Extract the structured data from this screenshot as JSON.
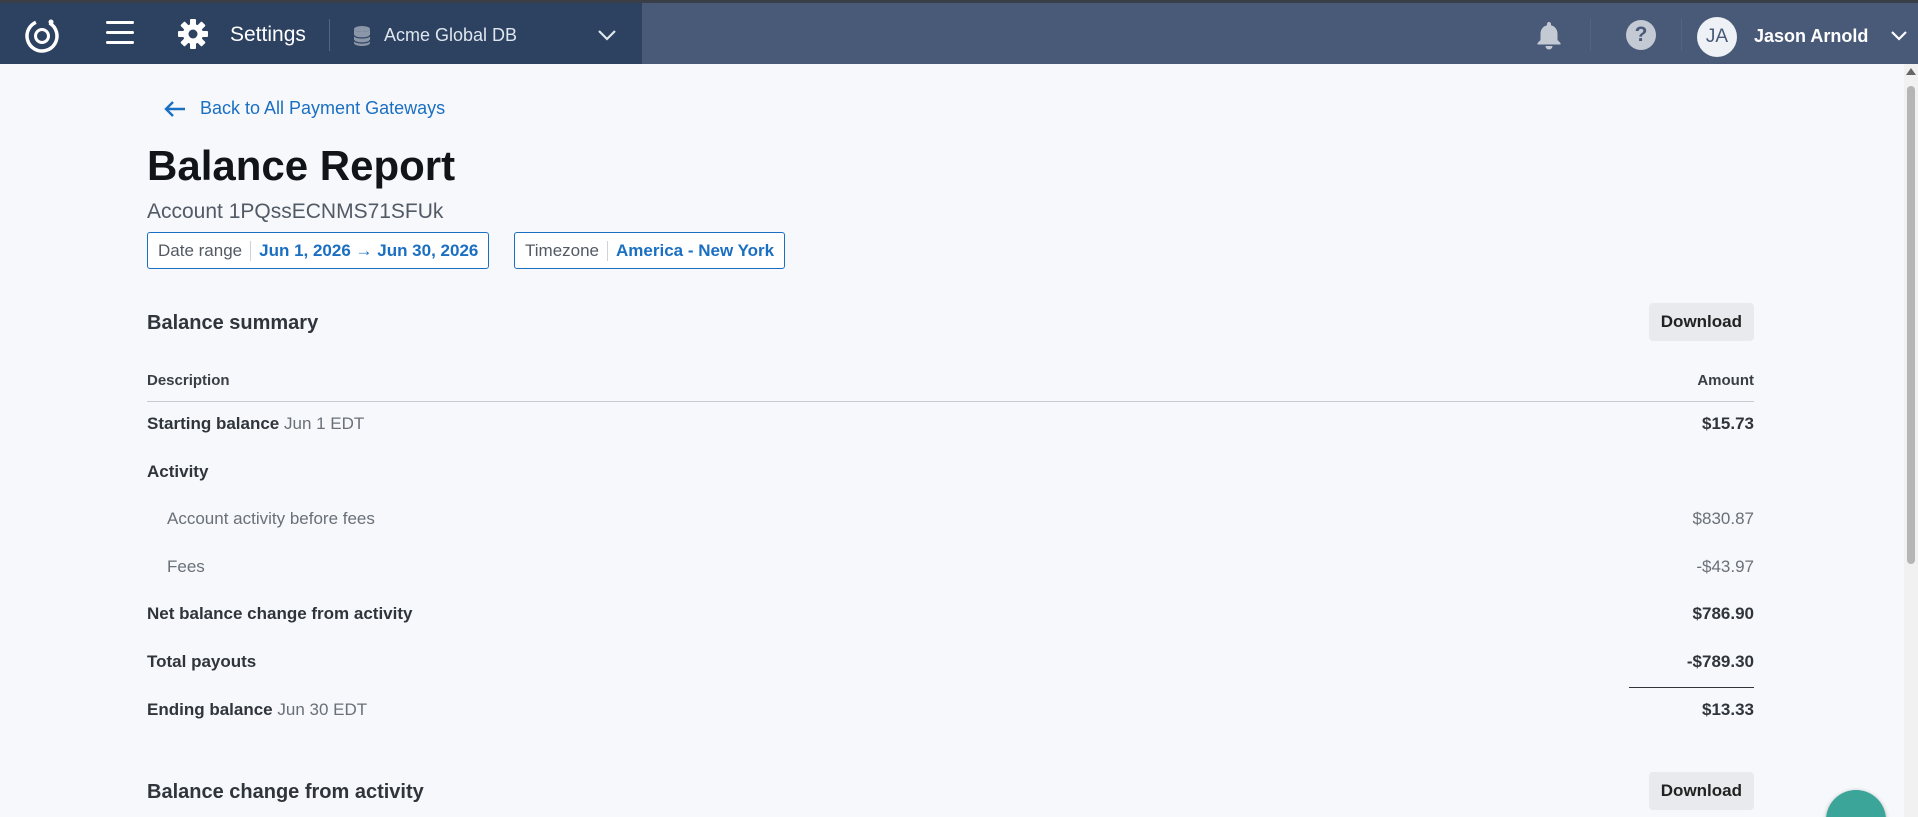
{
  "topbar": {
    "settings_label": "Settings",
    "database": "Acme Global DB",
    "user": {
      "initials": "JA",
      "name": "Jason Arnold"
    },
    "help_glyph": "?"
  },
  "page": {
    "back_link": "Back to All Payment Gateways",
    "title": "Balance Report",
    "account": "Account 1PQssECNMS71SFUk"
  },
  "filters": {
    "date_range": {
      "label": "Date range",
      "value": "Jun 1, 2026 → Jun 30, 2026"
    },
    "timezone": {
      "label": "Timezone",
      "value": "America - New York"
    }
  },
  "summary": {
    "title": "Balance summary",
    "download_label": "Download",
    "columns": {
      "description": "Description",
      "amount": "Amount"
    },
    "rows": [
      {
        "label": "Starting balance",
        "sub": "Jun 1 EDT",
        "amount": "$15.73"
      },
      {
        "label": "Activity",
        "sub": "",
        "amount": ""
      },
      {
        "label": "Account activity before fees",
        "sub": "",
        "amount": "$830.87"
      },
      {
        "label": "Fees",
        "sub": "",
        "amount": "-$43.97"
      },
      {
        "label": "Net balance change from activity",
        "sub": "",
        "amount": "$786.90"
      },
      {
        "label": "Total payouts",
        "sub": "",
        "amount": "-$789.30"
      },
      {
        "label": "Ending balance",
        "sub": "Jun 30 EDT",
        "amount": "$13.33"
      }
    ]
  },
  "activity": {
    "title": "Balance change from activity",
    "download_label": "Download"
  },
  "icons": {
    "logo": "logo-icon",
    "menu": "hamburger-icon",
    "settings": "gear-icon",
    "database": "database-icon",
    "notifications": "bell-icon",
    "help": "help-icon",
    "back": "arrow-left-icon"
  },
  "colors": {
    "topbar_left": "#2d4160",
    "topbar_right": "#485a78",
    "link": "#1b6fc2",
    "fab": "#3ba59a"
  }
}
